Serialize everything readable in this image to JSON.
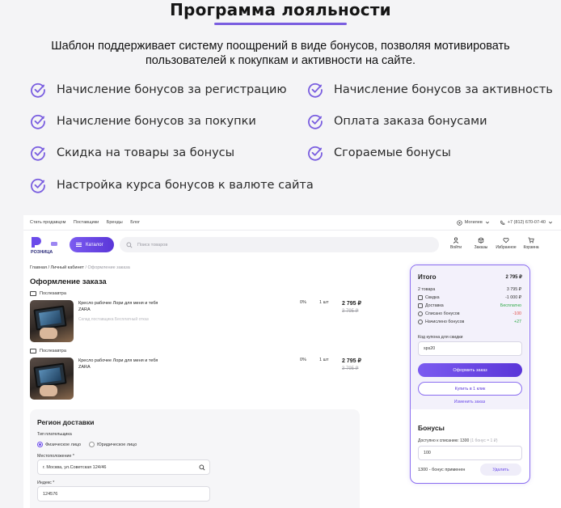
{
  "promo": {
    "title": "Программа лояльности",
    "description": "Шаблон поддерживает систему поощрений в виде бонусов, позволяя мотивировать пользователей к покупкам и активности на сайте.",
    "features": [
      "Начисление бонусов за регистрацию",
      "Начисление бонусов за активность",
      "Начисление бонусов за покупки",
      "Оплата заказа бонусами",
      "Скидка на товары за бонусы",
      "Сгораемые бонусы",
      "Настройка курса бонусов к валюте сайта"
    ],
    "accent_color": "#7a5ee0"
  },
  "site": {
    "topbar": {
      "links": [
        "Стать продавцом",
        "Поставщики",
        "Бренды",
        "Блог"
      ],
      "city": "Могилев",
      "phone": "+7 (812) 670-07-40"
    },
    "logo_text": "РОЗНИЦА",
    "catalog_label": "Каталог",
    "search_placeholder": "Поиск товаров",
    "header_icons": [
      {
        "icon": "user-icon",
        "label": "Войти"
      },
      {
        "icon": "box-icon",
        "label": "Заказы"
      },
      {
        "icon": "heart-icon",
        "label": "Избранное"
      },
      {
        "icon": "cart-icon",
        "label": "Корзина"
      }
    ],
    "breadcrumbs": [
      "Главная",
      "Личный кабинет",
      "Оформление заказа"
    ],
    "page_title": "Оформление заказа",
    "items": [
      {
        "delivery": "Послезавтра",
        "name": "Кресло рабочее Лори для меня и тебя",
        "brand": "ZARA",
        "supplier": "Склад поставщика  Бесплатный отказ",
        "discount": "0%",
        "qty": "1 шт",
        "price": "2 795 ₽",
        "old_price": "3 795 ₽"
      },
      {
        "delivery": "Послезавтра",
        "name": "Кресло рабочее Лори для меня и тебя",
        "brand": "ZARA",
        "supplier": "",
        "discount": "0%",
        "qty": "1 шт",
        "price": "2 795 ₽",
        "old_price": "3 795 ₽"
      }
    ],
    "region": {
      "title": "Регион доставки",
      "payer_label": "Тип плательщика",
      "payer_options": [
        "Физическое лицо",
        "Юридическое лицо"
      ],
      "location_label": "Местоположение *",
      "location_value": "г. Москва, ул.Советская 124/46",
      "index_label": "Индекс *",
      "index_value": "124576"
    },
    "summary": {
      "title": "Итого",
      "total": "2 795 ₽",
      "rows": [
        {
          "label": "2 товара",
          "value": "3 795 ₽",
          "tone": ""
        },
        {
          "label": "Скидка",
          "value": "-1 000 ₽",
          "tone": ""
        },
        {
          "label": "Доставка",
          "value": "Бесплатно",
          "tone": "green"
        },
        {
          "label": "Списано бонусов",
          "value": "-100",
          "tone": "red"
        },
        {
          "label": "Начислено бонусов",
          "value": "+27",
          "tone": "green"
        }
      ],
      "coupon_label": "Код купона для скидки",
      "coupon_value": "sps20",
      "checkout_label": "Оформить заказ",
      "oneclick_label": "Купить в 1 клик",
      "edit_label": "Изменить заказ",
      "bonus_title": "Бонусы",
      "bonus_available_label": "Доступно к списанию: 1300",
      "bonus_rate": "(1 бонус = 1 ₽)",
      "bonus_value": "100",
      "bonus_applied": "1300 - бонус применен",
      "bonus_remove": "Удалить"
    }
  }
}
